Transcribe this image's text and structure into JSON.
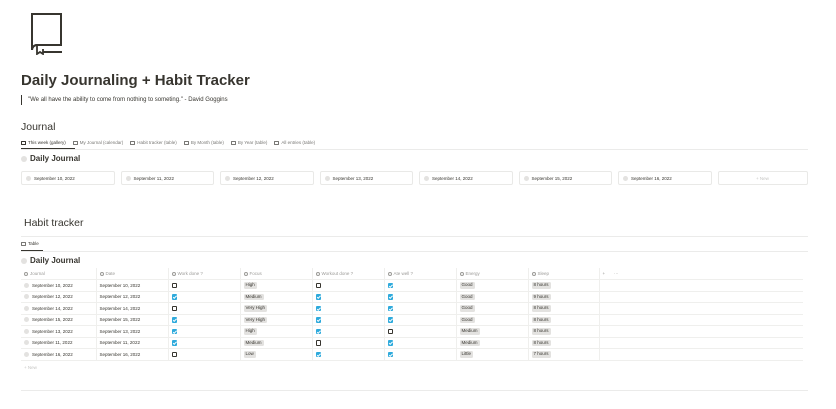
{
  "page": {
    "icon": "book-icon",
    "title": "Daily Journaling + Habit Tracker",
    "quote": "\"We all have the ability to come from nothing to someting.\" - David Goggins"
  },
  "journal": {
    "heading": "Journal",
    "tabs": [
      {
        "label": "This week (gallery)",
        "active": true
      },
      {
        "label": "My Journal (calendar)",
        "active": false
      },
      {
        "label": "Habit tracker (table)",
        "active": false
      },
      {
        "label": "By Month (table)",
        "active": false
      },
      {
        "label": "By Year (table)",
        "active": false
      },
      {
        "label": "All entries (table)",
        "active": false
      }
    ],
    "db_title": "Daily Journal",
    "cards": [
      "September 10, 2022",
      "September 11, 2022",
      "September 12, 2022",
      "September 13, 2022",
      "September 14, 2022",
      "September 15, 2022",
      "September 16, 2022"
    ],
    "new_label": "+ New"
  },
  "habit_tracker": {
    "heading": "Habit tracker",
    "tab_label": "Table",
    "db_title": "Daily Journal",
    "columns": [
      "Journal",
      "Date",
      "Work done ?",
      "Focus",
      "Workout done ?",
      "Ate well ?",
      "Energy",
      "Sleep"
    ],
    "rows": [
      {
        "journal": "September 10, 2022",
        "date": "September 10, 2022",
        "work": false,
        "focus": "High",
        "workout": false,
        "ate": true,
        "energy": "Good",
        "sleep": "8 hours"
      },
      {
        "journal": "September 12, 2022",
        "date": "September 12, 2022",
        "work": true,
        "focus": "Medium",
        "workout": true,
        "ate": true,
        "energy": "Good",
        "sleep": "9 hours"
      },
      {
        "journal": "September 14, 2022",
        "date": "September 14, 2022",
        "work": false,
        "focus": "Very High",
        "workout": true,
        "ate": true,
        "energy": "Good",
        "sleep": "8 hours"
      },
      {
        "journal": "September 15, 2022",
        "date": "September 15, 2022",
        "work": true,
        "focus": "Very High",
        "workout": true,
        "ate": true,
        "energy": "Good",
        "sleep": "8 hours"
      },
      {
        "journal": "September 13, 2022",
        "date": "September 13, 2022",
        "work": true,
        "focus": "High",
        "workout": true,
        "ate": false,
        "energy": "Medium",
        "sleep": "8 hours"
      },
      {
        "journal": "September 11, 2022",
        "date": "September 11, 2022",
        "work": true,
        "focus": "Medium",
        "workout": false,
        "ate": true,
        "energy": "Medium",
        "sleep": "8 hours"
      },
      {
        "journal": "September 16, 2022",
        "date": "September 16, 2022",
        "work": false,
        "focus": "Low",
        "workout": true,
        "ate": true,
        "energy": "Little",
        "sleep": "7 hours"
      }
    ],
    "add_column": "+",
    "more": "···",
    "new_label": "+ New"
  }
}
